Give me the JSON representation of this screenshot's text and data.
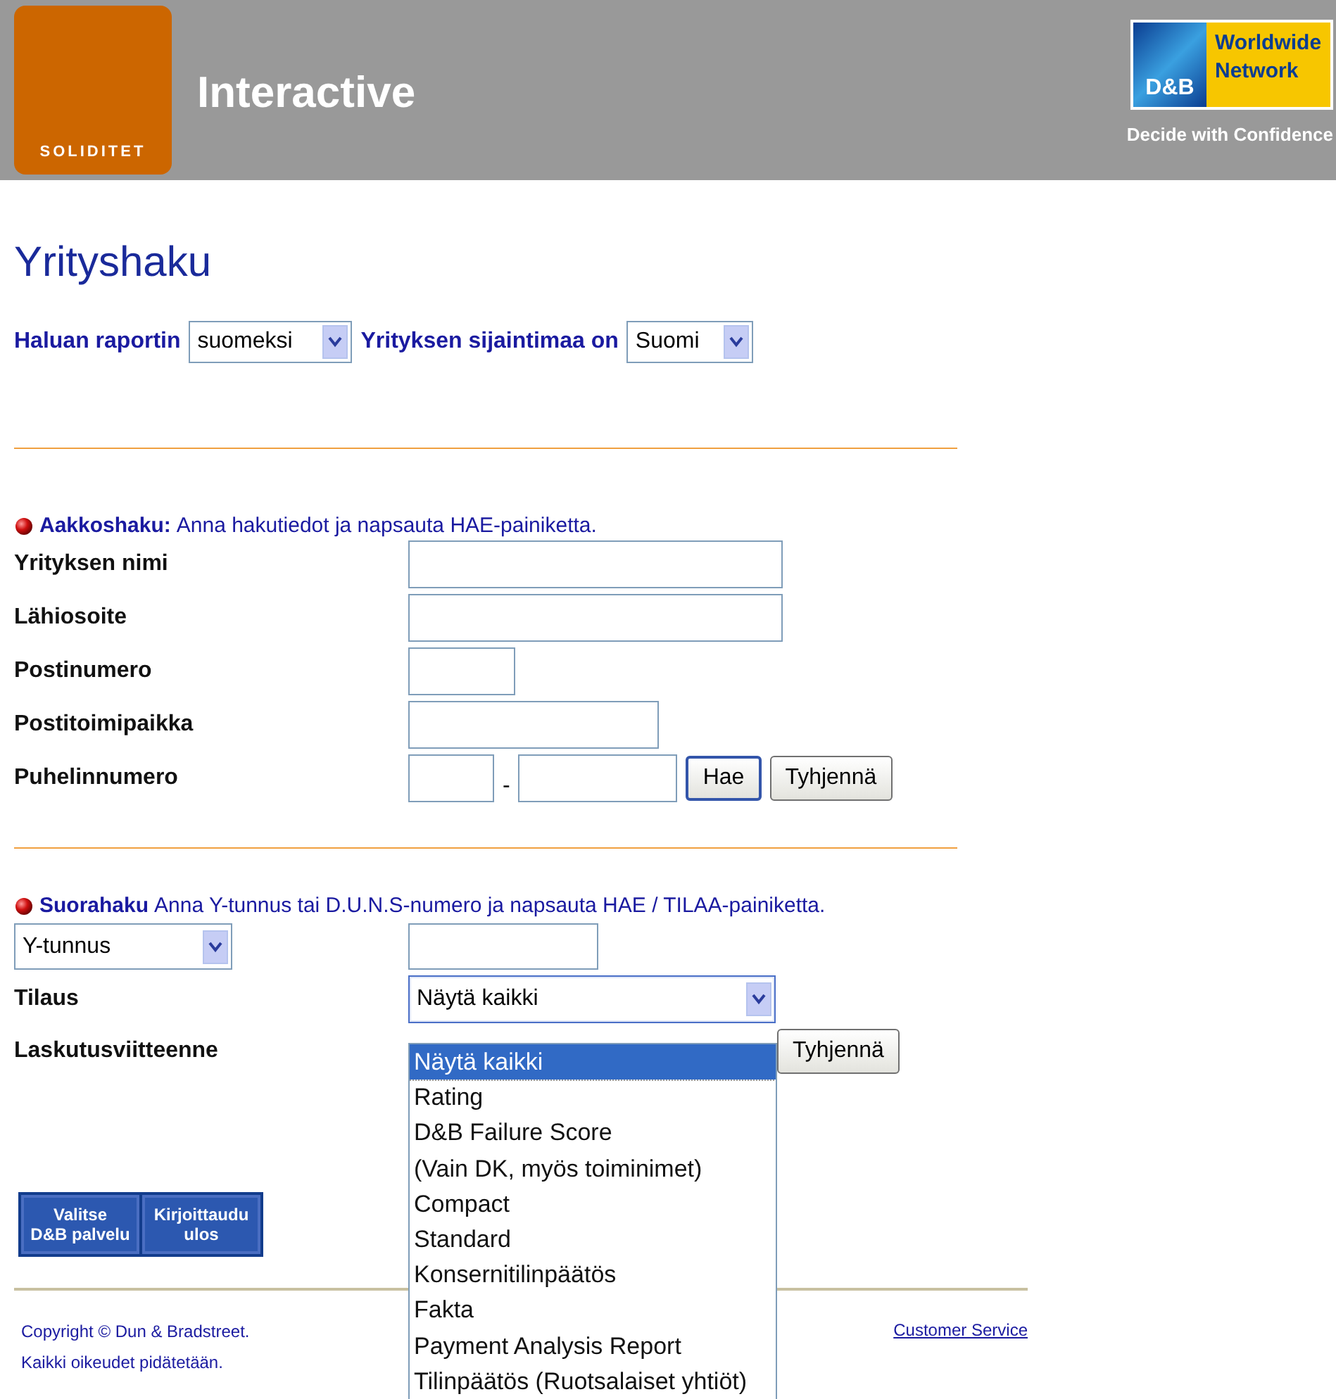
{
  "header": {
    "brand": "SOLIDITET",
    "product": "Interactive",
    "partner_logo": {
      "mark": "D&B",
      "lines": [
        "Worldwide",
        "Network"
      ]
    },
    "tagline": "Decide with Confidence"
  },
  "title": "Yrityshaku",
  "preferences": [
    {
      "label": "Haluan raportin",
      "value": "suomeksi"
    },
    {
      "label": "Yrityksen sijaintimaa on",
      "value": "Suomi"
    }
  ],
  "alpha_search": {
    "heading": "Aakkoshaku:",
    "instruction": "Anna hakutiedot ja napsauta HAE-painiketta.",
    "fields": [
      {
        "label": "Yrityksen nimi",
        "kind": "wide"
      },
      {
        "label": "Lähiosoite",
        "kind": "wide"
      },
      {
        "label": "Postinumero",
        "kind": "short"
      },
      {
        "label": "Postitoimipaikka",
        "kind": "medium"
      },
      {
        "label": "Puhelinnumero",
        "kind": "phone",
        "separator": "-"
      }
    ],
    "buttons": [
      {
        "label": "Hae",
        "focused": true
      },
      {
        "label": "Tyhjennä",
        "focused": false
      }
    ]
  },
  "direct_search": {
    "heading": "Suorahaku",
    "instruction": "Anna Y-tunnus tai D.U.N.S-numero ja napsauta HAE / TILAA-painiketta.",
    "id_type": "Y-tunnus",
    "order": {
      "label": "Tilaus",
      "value": "Näytä kaikki",
      "expanded": true,
      "options": [
        {
          "label": "Näytä kaikki",
          "selected": true
        },
        {
          "label": "Rating",
          "selected": false
        },
        {
          "label": "D&B Failure Score",
          "selected": false
        },
        {
          "label": "(Vain DK, myös toiminimet)",
          "selected": false
        },
        {
          "label": "Compact",
          "selected": false
        },
        {
          "label": "Standard",
          "selected": false
        },
        {
          "label": "Konsernitilinpäätös",
          "selected": false
        },
        {
          "label": "Fakta",
          "selected": false
        },
        {
          "label": "Payment Analysis Report",
          "selected": false
        },
        {
          "label": "Tilinpäätös (Ruotsalaiset yhtiöt)",
          "selected": false
        }
      ]
    },
    "reference": {
      "label": "Laskutusviitteenne",
      "button": "Tyhjennä"
    }
  },
  "nav_buttons": [
    {
      "lines": [
        "Valitse",
        "D&B palvelu"
      ]
    },
    {
      "lines": [
        "Kirjoittaudu",
        "ulos"
      ]
    }
  ],
  "footer": {
    "copyright": [
      "Copyright © Dun & Bradstreet.",
      "Kaikki oikeudet pidätetään."
    ],
    "link": "Customer Service"
  }
}
